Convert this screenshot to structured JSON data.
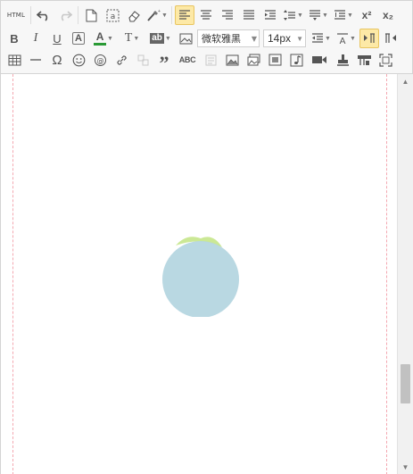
{
  "toolbar": {
    "html_label": "HTML",
    "font_family": "微软雅黑",
    "font_size": "14px",
    "bold": "B",
    "italic": "I",
    "underline": "U",
    "font_border": "A",
    "font_color": "A",
    "paragraph_format": "T",
    "backcolor": "ab",
    "quote": "”",
    "spellcheck": "ABC",
    "link": "@",
    "omega": "Ω",
    "superscript": "x²",
    "subscript": "x₂",
    "accent_color": "#2a9a35",
    "active_bg": "#fde9a6",
    "buttons": {
      "undo": "undo-icon",
      "redo": "redo-icon",
      "new_doc": "document-icon",
      "paste_text": "paste-text-icon",
      "clear_format": "eraser-icon",
      "format_brush": "brush-icon",
      "align_left": "align-left-icon",
      "align_center": "align-center-icon",
      "align_right": "align-right-icon",
      "align_justify": "align-justify-icon",
      "indent": "indent-icon",
      "row_spacing_top": "row-spacing-top-icon",
      "row_spacing_bottom": "row-spacing-bottom-icon",
      "line_height": "line-height-icon",
      "table": "table-icon",
      "horizontal_rule": "horizontal-rule-icon",
      "emotion": "smiley-icon",
      "insert_image": "image-icon",
      "insert_video": "video-icon",
      "music": "music-icon",
      "map": "map-icon",
      "fullscreen": "fullscreen-icon"
    }
  },
  "content": {
    "guide_color": "#f4a7b0",
    "loader_circle_color": "#b3d5df",
    "loader_arc_color": "#c5e58a"
  }
}
